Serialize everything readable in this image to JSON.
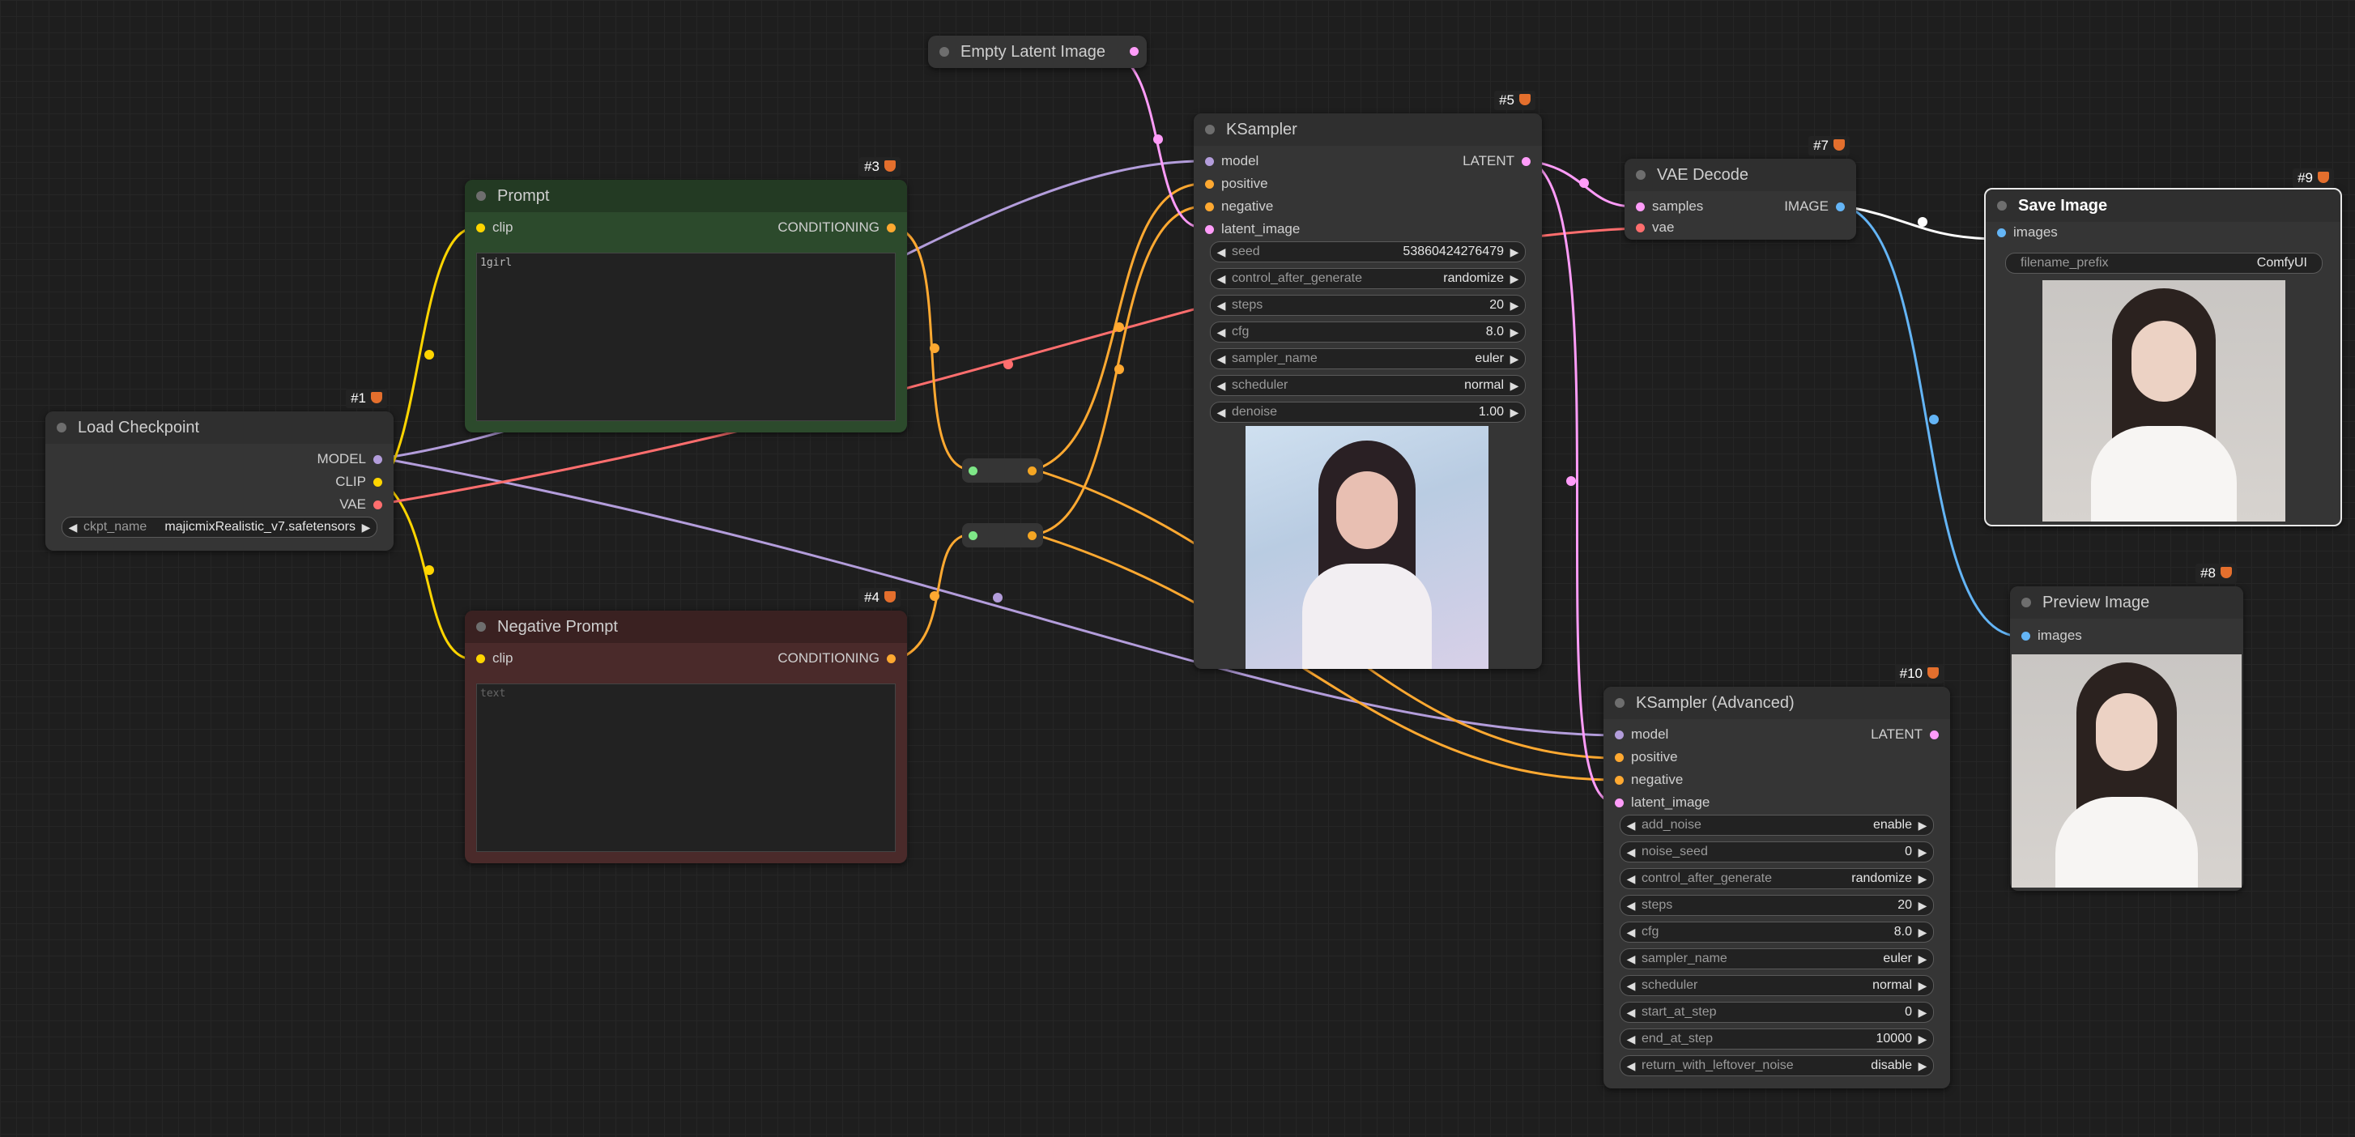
{
  "colors": {
    "model": "#b39ddb",
    "clip": "#ffd500",
    "vae": "#ff6e6e",
    "conditioning": "#ffa931",
    "latent": "#ff9cf9",
    "image": "#64b5f6",
    "green_node": "#2c4a2c",
    "red_node": "#4a2a2a"
  },
  "nodes": {
    "load_checkpoint": {
      "id": "#1",
      "title": "Load Checkpoint",
      "outputs": [
        "MODEL",
        "CLIP",
        "VAE"
      ],
      "ckpt_label": "ckpt_name",
      "ckpt_value": "majicmixRealistic_v7.safetensors"
    },
    "prompt": {
      "id": "#3",
      "title": "Prompt",
      "input": "clip",
      "output": "CONDITIONING",
      "text": "1girl"
    },
    "negative_prompt": {
      "id": "#4",
      "title": "Negative Prompt",
      "input": "clip",
      "output": "CONDITIONING",
      "placeholder": "text"
    },
    "empty_latent": {
      "title": "Empty Latent Image"
    },
    "ksampler": {
      "id": "#5",
      "title": "KSampler",
      "inputs": [
        "model",
        "positive",
        "negative",
        "latent_image"
      ],
      "output": "LATENT",
      "widgets": [
        {
          "label": "seed",
          "value": "53860424276479"
        },
        {
          "label": "control_after_generate",
          "value": "randomize"
        },
        {
          "label": "steps",
          "value": "20"
        },
        {
          "label": "cfg",
          "value": "8.0"
        },
        {
          "label": "sampler_name",
          "value": "euler"
        },
        {
          "label": "scheduler",
          "value": "normal"
        },
        {
          "label": "denoise",
          "value": "1.00"
        }
      ]
    },
    "vae_decode": {
      "id": "#7",
      "title": "VAE Decode",
      "inputs": [
        "samples",
        "vae"
      ],
      "output": "IMAGE"
    },
    "save_image": {
      "id": "#9",
      "title": "Save Image",
      "input": "images",
      "prefix_label": "filename_prefix",
      "prefix_value": "ComfyUI"
    },
    "preview_image": {
      "id": "#8",
      "title": "Preview Image",
      "input": "images"
    },
    "ksampler_adv": {
      "id": "#10",
      "title": "KSampler (Advanced)",
      "inputs": [
        "model",
        "positive",
        "negative",
        "latent_image"
      ],
      "output": "LATENT",
      "widgets": [
        {
          "label": "add_noise",
          "value": "enable"
        },
        {
          "label": "noise_seed",
          "value": "0"
        },
        {
          "label": "control_after_generate",
          "value": "randomize"
        },
        {
          "label": "steps",
          "value": "20"
        },
        {
          "label": "cfg",
          "value": "8.0"
        },
        {
          "label": "sampler_name",
          "value": "euler"
        },
        {
          "label": "scheduler",
          "value": "normal"
        },
        {
          "label": "start_at_step",
          "value": "0"
        },
        {
          "label": "end_at_step",
          "value": "10000"
        },
        {
          "label": "return_with_leftover_noise",
          "value": "disable"
        }
      ]
    }
  }
}
